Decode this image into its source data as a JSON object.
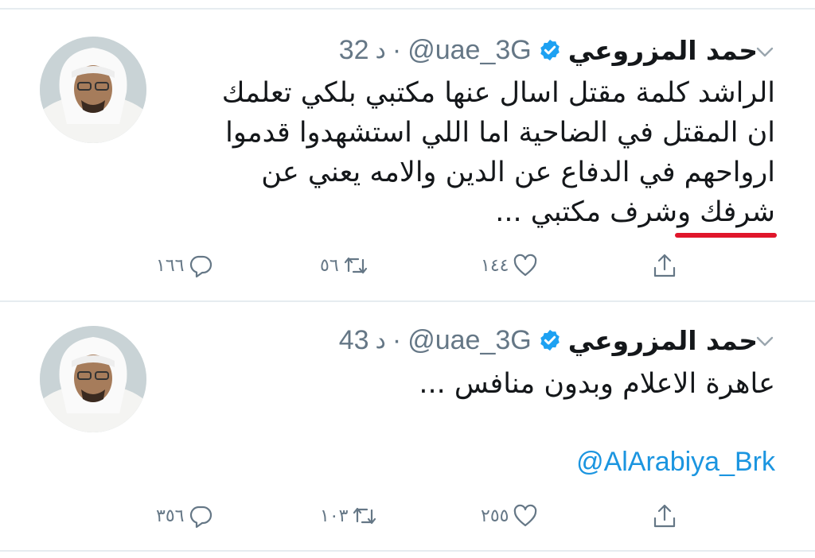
{
  "tweets": [
    {
      "name": "حمد المزروعي",
      "handle": "@uae_3G",
      "separator": "·",
      "time_value": "32",
      "time_unit": "د",
      "lines": [
        "الراشد كلمة مقتل اسال عنها مكتبي بلكي تعلمك",
        "ان المقتل في الضاحية اما اللي استشهدوا قدموا",
        "ارواحهم في الدفاع عن الدين والامه يعني عن",
        "شرفك وشرف مكتبي ..."
      ],
      "replies": "١٦٦",
      "retweets": "٥٦",
      "likes": "١٤٤"
    },
    {
      "name": "حمد المزروعي",
      "handle": "@uae_3G",
      "separator": "·",
      "time_value": "43",
      "time_unit": "د",
      "lines": [
        "عاهرة الاعلام وبدون منافس ..."
      ],
      "mention": "@AlArabiya_Brk",
      "replies": "٣٥٦",
      "retweets": "١٠٣",
      "likes": "٢٥٥"
    }
  ],
  "colors": {
    "accent": "#1b95e0",
    "muted": "#657786",
    "underline": "#e0162b",
    "divider": "#e6ecf0"
  },
  "icons": [
    "verified-badge-icon",
    "chevron-down-icon",
    "reply-icon",
    "retweet-icon",
    "like-icon",
    "share-icon"
  ]
}
